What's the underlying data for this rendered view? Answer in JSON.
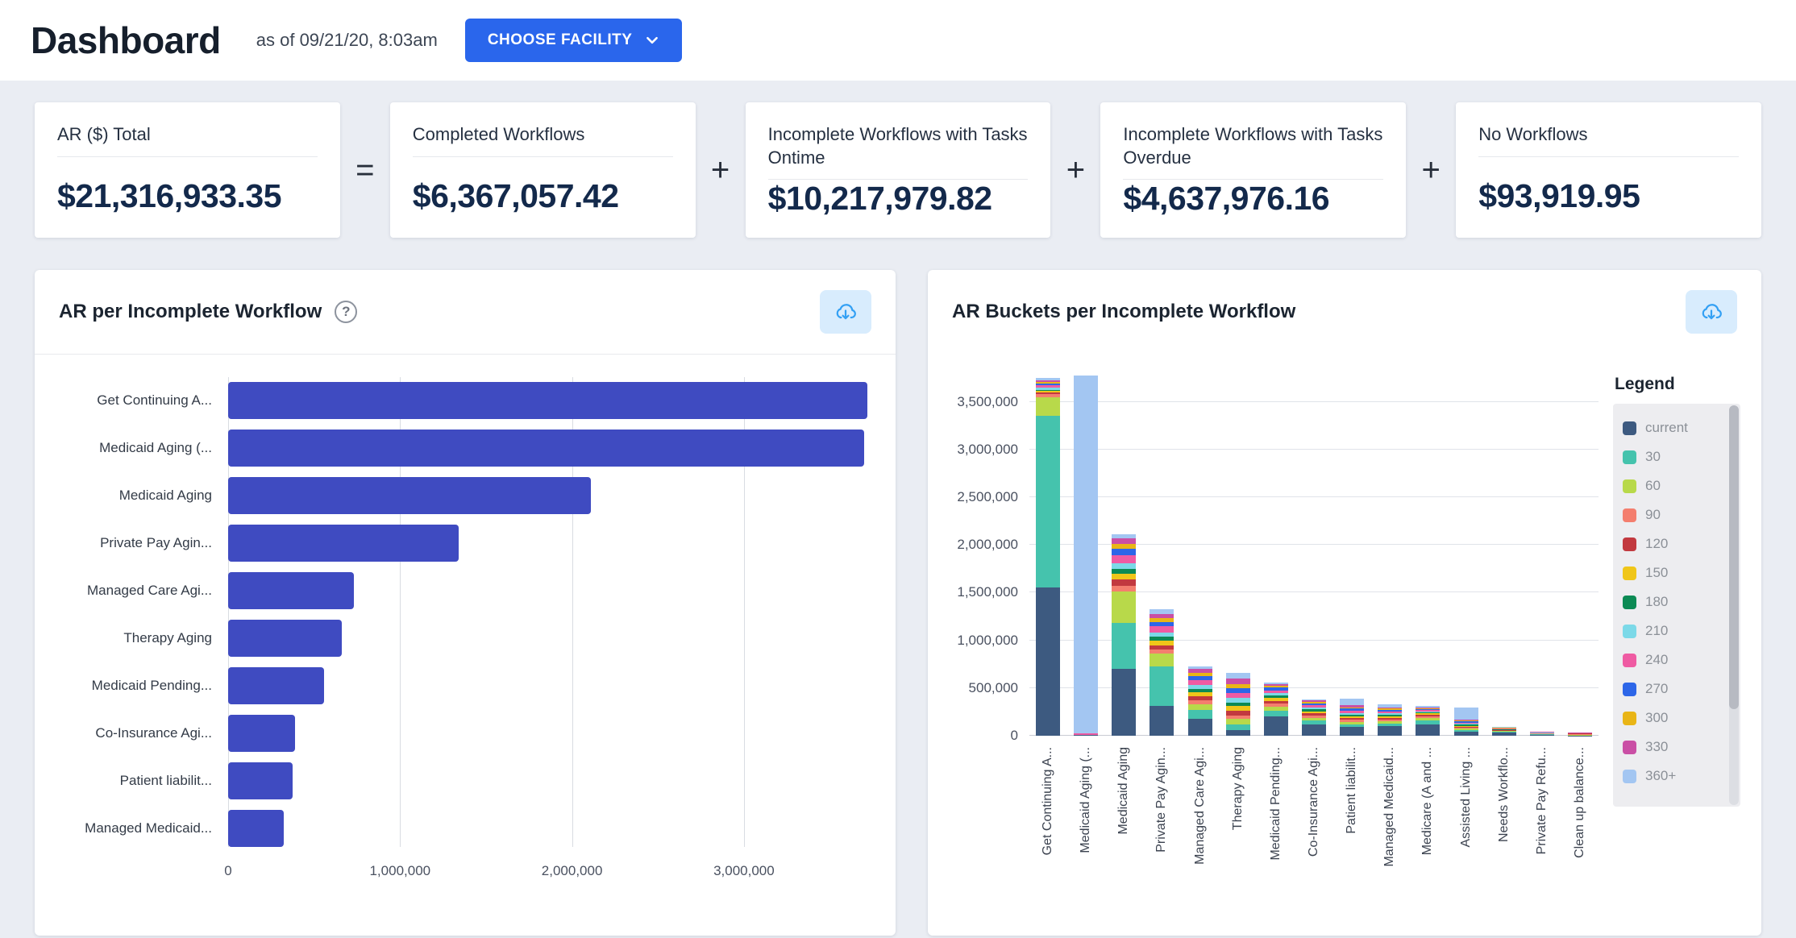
{
  "header": {
    "title": "Dashboard",
    "as_of": "as of 09/21/20, 8:03am",
    "choose_facility": "CHOOSE FACILITY"
  },
  "icons": {
    "help": "?"
  },
  "operators": [
    "=",
    "+",
    "+",
    "+"
  ],
  "kpis": [
    {
      "label": "AR ($) Total",
      "value": "$21,316,933.35"
    },
    {
      "label": "Completed Workflows",
      "value": "$6,367,057.42"
    },
    {
      "label": "Incomplete Workflows with Tasks Ontime",
      "value": "$10,217,979.82"
    },
    {
      "label": "Incomplete Workflows with Tasks Overdue",
      "value": "$4,637,976.16"
    },
    {
      "label": "No Workflows",
      "value": "$93,919.95"
    }
  ],
  "chart_data": [
    {
      "type": "bar",
      "orientation": "horizontal",
      "title": "AR per Incomplete Workflow",
      "bar_color": "#3f4bc1",
      "categories": [
        "Get Continuing A...",
        "Medicaid Aging (...",
        "Medicaid Aging",
        "Private Pay Agin...",
        "Managed Care Agi...",
        "Therapy Aging",
        "Medicaid Pending...",
        "Co-Insurance Agi...",
        "Patient liabilit...",
        "Managed Medicaid..."
      ],
      "values": [
        3720000,
        3700000,
        2110000,
        1340000,
        730000,
        660000,
        560000,
        390000,
        375000,
        325000
      ],
      "xlim": [
        0,
        3760000
      ],
      "x_ticks": [
        0,
        1000000,
        2000000,
        3000000
      ],
      "x_tick_labels": [
        "0",
        "1,000,000",
        "2,000,000",
        "3,000,000"
      ],
      "grid": true
    },
    {
      "type": "stacked_bar",
      "title": "AR Buckets per Incomplete Workflow",
      "legend_title": "Legend",
      "legend_position": "right",
      "categories": [
        "Get Continuing A...",
        "Medicaid Aging (...",
        "Medicaid Aging",
        "Private Pay Agin...",
        "Managed Care Agi...",
        "Therapy Aging",
        "Medicaid Pending...",
        "Co-Insurance Agi...",
        "Patient liabilit...",
        "Managed Medicaid...",
        "Medicare (A and ...",
        "Assisted Living ...",
        "Needs Workflo...",
        "Private Pay Refu...",
        "Clean up balance..."
      ],
      "ylim": [
        0,
        3800000
      ],
      "y_ticks": [
        0,
        500000,
        1000000,
        1500000,
        2000000,
        2500000,
        3000000,
        3500000
      ],
      "y_tick_labels": [
        "0",
        "500,000",
        "1,000,000",
        "1,500,000",
        "2,000,000",
        "2,500,000",
        "3,000,000",
        "3,500,000"
      ],
      "grid": true,
      "series": [
        {
          "name": "current",
          "color": "#3d5a80",
          "values": [
            1550000,
            10000,
            700000,
            310000,
            180000,
            60000,
            200000,
            120000,
            90000,
            100000,
            120000,
            40000,
            30000,
            10000,
            2000
          ]
        },
        {
          "name": "30",
          "color": "#45c3ad",
          "values": [
            1800000,
            0,
            480000,
            420000,
            90000,
            60000,
            60000,
            40000,
            30000,
            30000,
            40000,
            20000,
            10000,
            5000,
            2000
          ]
        },
        {
          "name": "60",
          "color": "#b8d94a",
          "values": [
            200000,
            0,
            330000,
            130000,
            60000,
            55000,
            45000,
            30000,
            25000,
            25000,
            30000,
            15000,
            8000,
            4000,
            2000
          ]
        },
        {
          "name": "90",
          "color": "#f47e6e",
          "values": [
            30000,
            0,
            60000,
            40000,
            40000,
            40000,
            30000,
            20000,
            20000,
            15000,
            15000,
            10000,
            5000,
            3000,
            15000
          ]
        },
        {
          "name": "120",
          "color": "#c2393f",
          "values": [
            20000,
            0,
            70000,
            50000,
            45000,
            45000,
            30000,
            25000,
            20000,
            20000,
            15000,
            10000,
            5000,
            3000,
            2000
          ]
        },
        {
          "name": "150",
          "color": "#f0c619",
          "values": [
            15000,
            0,
            60000,
            45000,
            40000,
            50000,
            30000,
            20000,
            20000,
            15000,
            15000,
            10000,
            5000,
            2000,
            1000
          ]
        },
        {
          "name": "180",
          "color": "#0c8a54",
          "values": [
            10000,
            0,
            50000,
            40000,
            35000,
            40000,
            25000,
            20000,
            15000,
            15000,
            10000,
            10000,
            4000,
            2000,
            1000
          ]
        },
        {
          "name": "210",
          "color": "#7cd9e8",
          "values": [
            20000,
            0,
            60000,
            50000,
            40000,
            45000,
            25000,
            20000,
            20000,
            15000,
            10000,
            10000,
            4000,
            2000,
            1000
          ]
        },
        {
          "name": "240",
          "color": "#ef5ba3",
          "values": [
            25000,
            15000,
            80000,
            60000,
            50000,
            55000,
            30000,
            25000,
            25000,
            20000,
            15000,
            15000,
            5000,
            3000,
            2000
          ]
        },
        {
          "name": "270",
          "color": "#2d66e8",
          "values": [
            20000,
            0,
            70000,
            50000,
            45000,
            50000,
            30000,
            20000,
            20000,
            15000,
            10000,
            10000,
            4000,
            2000,
            1000
          ]
        },
        {
          "name": "300",
          "color": "#e9b517",
          "values": [
            15000,
            0,
            50000,
            40000,
            35000,
            45000,
            20000,
            15000,
            15000,
            15000,
            10000,
            10000,
            3000,
            2000,
            1000
          ]
        },
        {
          "name": "330",
          "color": "#ca4fa5",
          "values": [
            20000,
            0,
            60000,
            45000,
            40000,
            55000,
            20000,
            15000,
            20000,
            15000,
            10000,
            10000,
            3000,
            2000,
            1000
          ]
        },
        {
          "name": "360+",
          "color": "#a3c6f2",
          "values": [
            25000,
            3750000,
            40000,
            50000,
            30000,
            60000,
            15000,
            10000,
            70000,
            30000,
            10000,
            130000,
            4000,
            2000,
            1000
          ]
        }
      ]
    }
  ],
  "colors": {
    "accent_blue": "#2a66ec",
    "bar_indigo": "#3f4bc1",
    "page_bg": "#eaedf3",
    "value_navy": "#13294b",
    "download_btn_bg": "#d8ecfd",
    "download_icon": "#33a0f4"
  }
}
